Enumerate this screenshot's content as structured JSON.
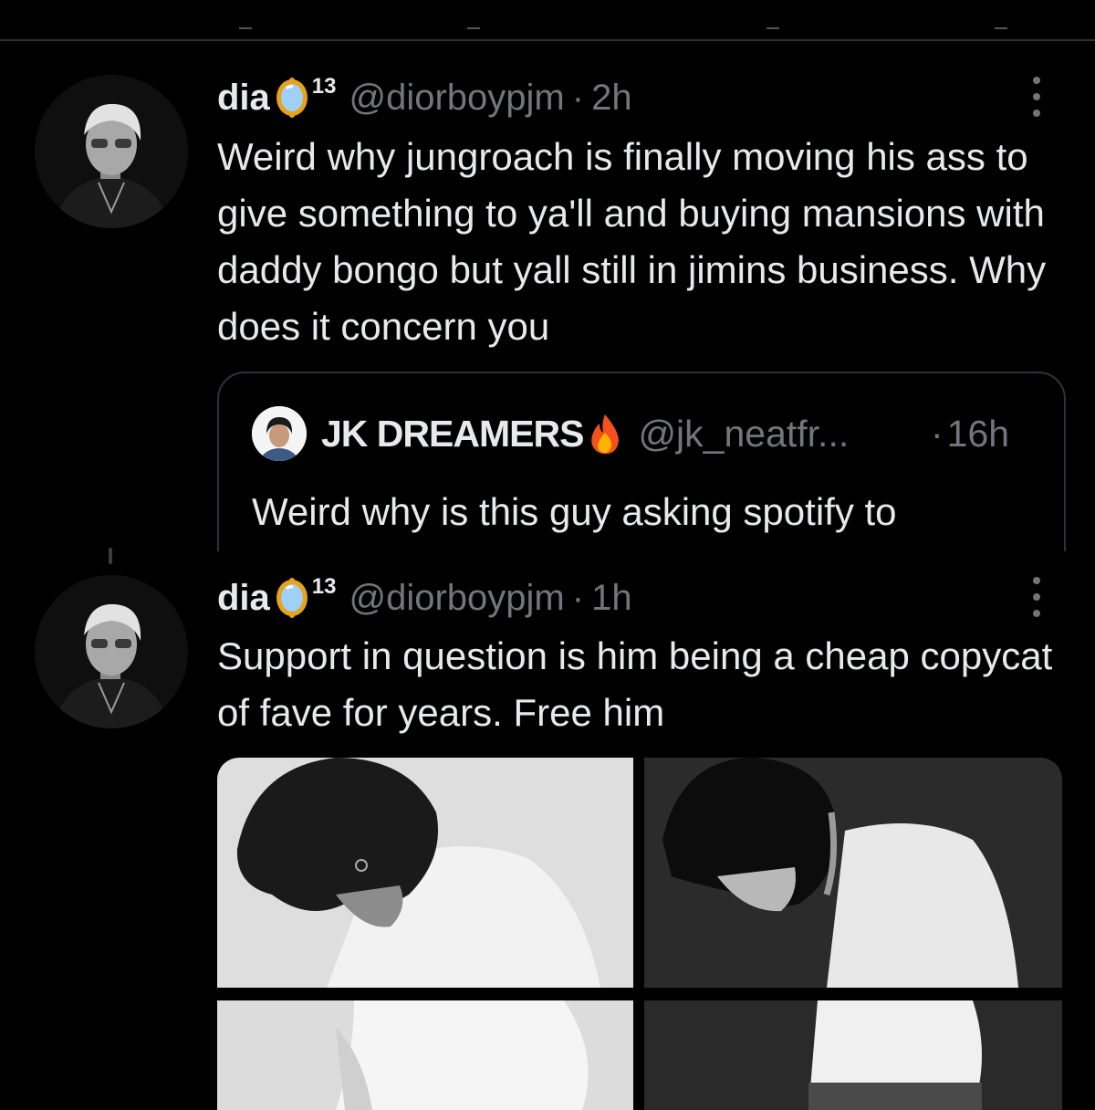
{
  "tweets": [
    {
      "display_name": "dia",
      "badge_icon": "mirror-emoji-icon",
      "badge_number": "13",
      "handle": "@diorboypjm",
      "separator": "·",
      "time": "2h",
      "text": "Weird why jungroach is finally moving his ass to give something to ya'll and buying mansions with daddy bongo but yall still in jimins business. Why does it concern you",
      "quote": {
        "display_name": "JK DREAMERS",
        "emoji_icon": "fire-emoji-icon",
        "handle": "@jk_neatfr...",
        "separator": "·",
        "time": "16h",
        "text": "Weird why is this guy asking spotify to"
      }
    },
    {
      "display_name": "dia",
      "badge_icon": "mirror-emoji-icon",
      "badge_number": "13",
      "handle": "@diorboypjm",
      "separator": "·",
      "time": "1h",
      "text": "Support in question is him being a cheap copycat of fave for years. Free him",
      "media_count": 4
    }
  ],
  "colors": {
    "background": "#000000",
    "text": "#e7e9ea",
    "secondary": "#71767b",
    "border": "#2f3336"
  }
}
